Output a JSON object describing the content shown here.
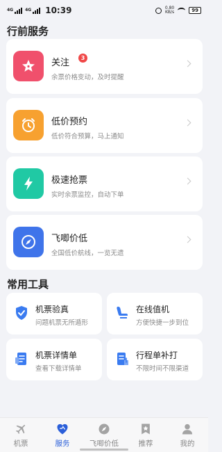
{
  "status_bar": {
    "network_1": "4G",
    "network_2": "4G",
    "time": "10:39",
    "speed_value": "0.80",
    "speed_unit": "KB/s",
    "battery": "99"
  },
  "sections": {
    "services_title": "行前服务",
    "tools_title": "常用工具"
  },
  "services": [
    {
      "title": "关注",
      "subtitle": "余票价格变动，及时提醒",
      "badge": "3",
      "icon": "star-icon",
      "color": "#f0506c"
    },
    {
      "title": "低价预约",
      "subtitle": "低价符合预算，马上通知",
      "icon": "alarm-clock-icon",
      "color": "#f7a130"
    },
    {
      "title": "极速抢票",
      "subtitle": "实时余票监控，自动下单",
      "icon": "lightning-icon",
      "color": "#20c9a4"
    },
    {
      "title": "飞唧价低",
      "subtitle": "全国低价航线，一览无遗",
      "icon": "compass-icon",
      "color": "#3f74ea"
    }
  ],
  "tools": [
    {
      "title": "机票验真",
      "subtitle": "问题机票无所遁形",
      "icon": "shield-check-icon"
    },
    {
      "title": "在线值机",
      "subtitle": "方便快捷一步到位",
      "icon": "seat-icon"
    },
    {
      "title": "机票详情单",
      "subtitle": "查看下载详情单",
      "icon": "ticket-detail-icon"
    },
    {
      "title": "行程单补打",
      "subtitle": "不限时间不限渠道",
      "icon": "itinerary-icon"
    }
  ],
  "tab_bar": [
    {
      "label": "机票",
      "icon": "plane-icon",
      "active": false
    },
    {
      "label": "服务",
      "icon": "heart-icon",
      "active": true
    },
    {
      "label": "飞唧价低",
      "icon": "compass-icon",
      "active": false
    },
    {
      "label": "推荐",
      "icon": "bookmark-star-icon",
      "active": false
    },
    {
      "label": "我的",
      "icon": "user-icon",
      "active": false
    }
  ],
  "colors": {
    "accent": "#2b5fd9",
    "background": "#f2f3f7",
    "badge": "#f04848",
    "tool_icon": "#3a7bf0"
  }
}
